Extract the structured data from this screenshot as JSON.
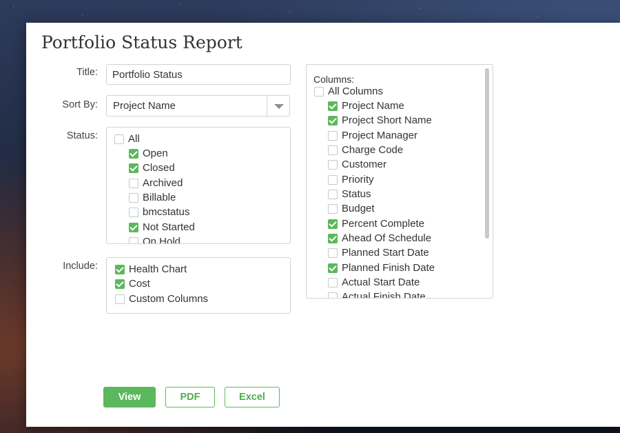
{
  "dialog": {
    "title": "Portfolio Status Report"
  },
  "form": {
    "title_label": "Title:",
    "title_value": "Portfolio Status",
    "sort_label": "Sort By:",
    "sort_value": "Project Name",
    "status_label": "Status:",
    "status_items": [
      {
        "label": "All",
        "checked": false
      },
      {
        "label": "Open",
        "checked": true
      },
      {
        "label": "Closed",
        "checked": true
      },
      {
        "label": "Archived",
        "checked": false
      },
      {
        "label": "Billable",
        "checked": false
      },
      {
        "label": "bmcstatus",
        "checked": false
      },
      {
        "label": "Not Started",
        "checked": true
      },
      {
        "label": "On Hold",
        "checked": false
      }
    ],
    "include_label": "Include:",
    "include_items": [
      {
        "label": "Health Chart",
        "checked": true
      },
      {
        "label": "Cost",
        "checked": true
      },
      {
        "label": "Custom Columns",
        "checked": false
      }
    ]
  },
  "columns": {
    "header": "Columns:",
    "items": [
      {
        "label": "All Columns",
        "checked": false
      },
      {
        "label": "Project Name",
        "checked": true
      },
      {
        "label": "Project Short Name",
        "checked": true
      },
      {
        "label": "Project Manager",
        "checked": false
      },
      {
        "label": "Charge Code",
        "checked": false
      },
      {
        "label": "Customer",
        "checked": false
      },
      {
        "label": "Priority",
        "checked": false
      },
      {
        "label": "Status",
        "checked": false
      },
      {
        "label": "Budget",
        "checked": false
      },
      {
        "label": "Percent Complete",
        "checked": true
      },
      {
        "label": "Ahead Of Schedule",
        "checked": true
      },
      {
        "label": "Planned Start Date",
        "checked": false
      },
      {
        "label": "Planned Finish Date",
        "checked": true
      },
      {
        "label": "Actual Start Date",
        "checked": false
      },
      {
        "label": "Actual Finish Date",
        "checked": false
      }
    ]
  },
  "buttons": {
    "view": "View",
    "pdf": "PDF",
    "excel": "Excel"
  },
  "colors": {
    "accent": "#5cb85c",
    "border": "#cfd3d7",
    "text": "#333333"
  }
}
